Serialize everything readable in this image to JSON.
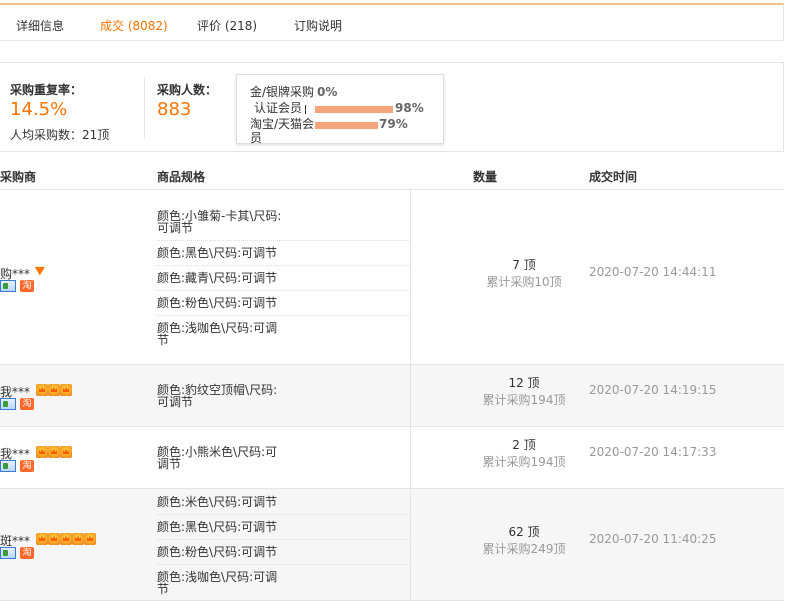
{
  "tabs": [
    {
      "label": "详细信息",
      "active": false
    },
    {
      "label": "成交 (8082)",
      "active": true
    },
    {
      "label": "评价 (218)",
      "active": false
    },
    {
      "label": "订购说明",
      "active": false
    }
  ],
  "stats": {
    "repeat_label": "采购重复率：",
    "repeat_value": "14.5%",
    "avg_label": "人均采购数：",
    "avg_value": "21顶",
    "buyers_label": "采购人数：",
    "buyers_value": "883"
  },
  "popup": {
    "rows": [
      {
        "label": "金/银牌采购",
        "pct": "0%",
        "fraction": 0.0
      },
      {
        "label": "认证会员",
        "pct": "98%",
        "fraction": 0.98
      },
      {
        "label": "淘宝/天猫会员",
        "pct": "79%",
        "fraction": 0.79
      }
    ]
  },
  "table": {
    "headers": [
      "采购商",
      "商品规格",
      "数量",
      "成交时间"
    ],
    "rows": [
      {
        "buyer": "购***",
        "badge": "diamond",
        "specs": [
          "颜色:小雏菊-卡其\\尺码:可调节",
          "颜色:黑色\\尺码:可调节",
          "颜色:藏青\\尺码:可调节",
          "颜色:粉色\\尺码:可调节",
          "颜色:浅咖色\\尺码:可调节"
        ],
        "qty": "7 顶",
        "total": "累计采购10顶",
        "time": "2020-07-20 14:44:11"
      },
      {
        "buyer": "我***",
        "badge": "crown3",
        "specs": [
          "颜色:豹纹空顶帽\\尺码:可调节"
        ],
        "qty": "12 顶",
        "total": "累计采购194顶",
        "time": "2020-07-20 14:19:15"
      },
      {
        "buyer": "我***",
        "badge": "crown3",
        "specs": [
          "颜色:小熊米色\\尺码:可调节"
        ],
        "qty": "2 顶",
        "total": "累计采购194顶",
        "time": "2020-07-20 14:17:33"
      },
      {
        "buyer": "斑***",
        "badge": "crown5",
        "specs": [
          "颜色:米色\\尺码:可调节",
          "颜色:黑色\\尺码:可调节",
          "颜色:粉色\\尺码:可调节",
          "颜色:浅咖色\\尺码:可调节"
        ],
        "qty": "62 顶",
        "total": "累计采购249顶",
        "time": "2020-07-20 11:40:25"
      }
    ]
  },
  "icons": {
    "vip": "verified-member-icon",
    "taobao": "taobao-icon",
    "taobao_glyph": "淘"
  },
  "colors": {
    "accent": "#ff7300",
    "bar": "#f6a67d",
    "alt_row": "#f6f6f6"
  }
}
